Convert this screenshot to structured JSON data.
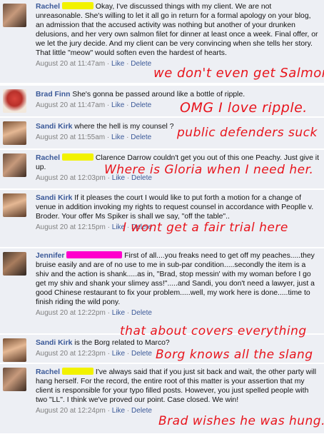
{
  "comments": [
    {
      "author": "Rachel",
      "redaction_color": "#f2f200",
      "text": "Okay, I've discussed things with my client. We are not unreasonable. She's willing to let it all go in return for a formal apology on your blog, an admission that the accused activity was nothing but another of your drunken delusions, and her very own salmon filet for dinner at least once a week. Final offer, or we let the jury decide. And my client can be very convincing when she tells her story. That little \"meow\" would soften even the hardest of hearts.",
      "time": "August 20 at 11:47am",
      "like": "Like",
      "delete": "Delete",
      "sep": "·"
    },
    {
      "author": "Brad Finn",
      "text": "She's gonna be passed around like a bottle of ripple.",
      "time": "August 20 at 11:47am",
      "like": "Like",
      "delete": "Delete",
      "sep": "·"
    },
    {
      "author": "Sandi Kirk",
      "text": "where the hell is my counsel ?",
      "time": "August 20 at 11:55am",
      "like": "Like",
      "delete": "Delete",
      "sep": "·"
    },
    {
      "author": "Rachel",
      "redaction_color": "#f2f200",
      "text": "Clarence Darrow couldn't get you out of this one Peachy. Just give it up.",
      "time": "August 20 at 12:03pm",
      "like": "Like",
      "delete": "Delete",
      "sep": "·"
    },
    {
      "author": "Sandi Kirk",
      "text": "If it pleases the court I would like to put forth a motion for a change of venue in addition invoking my rights to request counsel in accordance with Peoplle v. Broder. Your offer Ms Spiker is shall we say, \"off the table\"..",
      "time": "August 20 at 12:15pm",
      "like": "Like",
      "delete": "Delete",
      "sep": "·"
    },
    {
      "author": "Jennifer",
      "redaction_color": "#ff00cc",
      "text": "First of all....you freaks need to get off my peaches.....they bruise easily and are of no use to me in sub-par condition.....secondly the item is a shiv and the action is shank.....as in, \"Brad, stop messin' with my woman before I go get my shiv and shank your slimey ass!\".....and Sandi, you don't need a lawyer, just a good Chinese restaurant to fix your problem.....well, my work here is done.....time to finish riding the wild pony.",
      "time": "August 20 at 12:22pm",
      "like": "Like",
      "delete": "Delete",
      "sep": "·"
    },
    {
      "author": "Sandi Kirk",
      "text": "is the Borg related to Marco?",
      "time": "August 20 at 12:23pm",
      "like": "Like",
      "delete": "Delete",
      "sep": "·"
    },
    {
      "author": "Rachel",
      "redaction_color": "#f2f200",
      "text": "I've always said that if you just sit back and wait, the other party will hang herself. For the record, the entire root of this matter is your assertion that my client is responsible for your typo filled posts. However, you just spelled people with two \"LL\". I think we've proved our point. Case closed. We win!",
      "time": "August 20 at 12:24pm",
      "like": "Like",
      "delete": "Delete",
      "sep": "·"
    }
  ],
  "annotations": [
    "we don't even get Salmon",
    "OMG I love ripple.",
    "public defenders suck",
    "Where is Gloria when I need her.",
    "I wont get a fair trial here",
    "that about covers everything",
    "Borg knows all the slang",
    "Brad wishes he was hung."
  ],
  "colors": {
    "link": "#3b5998",
    "comment_bg": "#edeff4",
    "annotation": "#e8141c"
  }
}
